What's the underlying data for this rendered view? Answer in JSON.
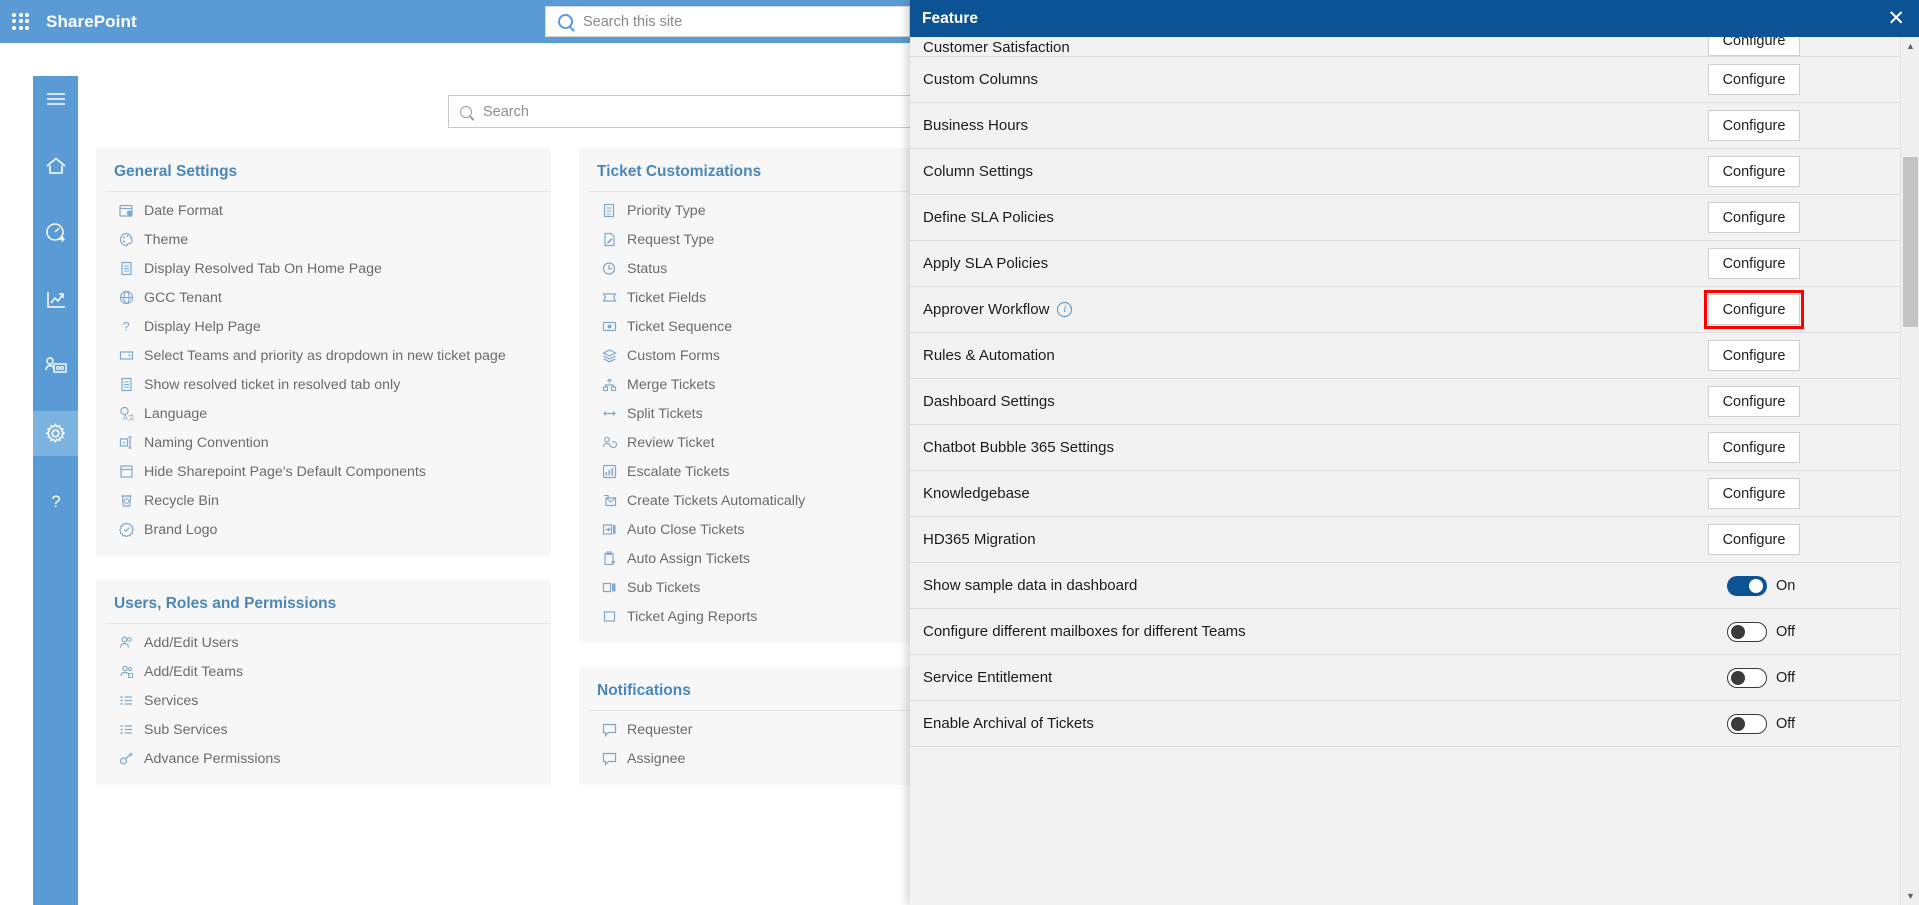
{
  "suitebar": {
    "app_launcher": "waffle-icon",
    "brand": "SharePoint",
    "search_placeholder": "Search this site"
  },
  "rail": {
    "items": [
      {
        "name": "hamburger-menu",
        "label": "Menu"
      },
      {
        "name": "home",
        "label": "Home"
      },
      {
        "name": "dashboard",
        "label": "Dashboard"
      },
      {
        "name": "reports",
        "label": "Reports"
      },
      {
        "name": "teams",
        "label": "Teams"
      },
      {
        "name": "settings",
        "label": "Settings",
        "active": true
      },
      {
        "name": "help",
        "label": "Help"
      }
    ]
  },
  "page": {
    "search_placeholder": "Search"
  },
  "settings_columns": [
    {
      "cards": [
        {
          "title": "General Settings",
          "items": [
            {
              "icon": "calendar-clock-icon",
              "label": "Date Format"
            },
            {
              "icon": "palette-icon",
              "label": "Theme"
            },
            {
              "icon": "document-icon",
              "label": "Display Resolved Tab On Home Page"
            },
            {
              "icon": "globe-icon",
              "label": "GCC Tenant"
            },
            {
              "icon": "question-icon",
              "label": "Display Help Page"
            },
            {
              "icon": "dropdown-icon",
              "label": "Select Teams and priority as dropdown in new ticket page"
            },
            {
              "icon": "document-icon",
              "label": "Show resolved ticket in resolved tab only"
            },
            {
              "icon": "language-icon",
              "label": "Language"
            },
            {
              "icon": "rename-icon",
              "label": "Naming Convention"
            },
            {
              "icon": "page-icon",
              "label": "Hide Sharepoint Page's Default Components"
            },
            {
              "icon": "recycle-bin-icon",
              "label": "Recycle Bin"
            },
            {
              "icon": "badge-icon",
              "label": "Brand Logo"
            }
          ]
        },
        {
          "title": "Users, Roles and Permissions",
          "items": [
            {
              "icon": "users-icon",
              "label": "Add/Edit Users"
            },
            {
              "icon": "team-icon",
              "label": "Add/Edit Teams"
            },
            {
              "icon": "list-icon",
              "label": "Services"
            },
            {
              "icon": "list-icon",
              "label": "Sub Services"
            },
            {
              "icon": "key-icon",
              "label": "Advance Permissions"
            }
          ]
        }
      ]
    },
    {
      "cards": [
        {
          "title": "Ticket Customizations",
          "items": [
            {
              "icon": "priority-icon",
              "label": "Priority Type"
            },
            {
              "icon": "request-icon",
              "label": "Request Type"
            },
            {
              "icon": "clock-icon",
              "label": "Status"
            },
            {
              "icon": "ticket-icon",
              "label": "Ticket Fields"
            },
            {
              "icon": "sequence-icon",
              "label": "Ticket Sequence"
            },
            {
              "icon": "layers-icon",
              "label": "Custom Forms"
            },
            {
              "icon": "merge-icon",
              "label": "Merge Tickets"
            },
            {
              "icon": "split-icon",
              "label": "Split Tickets"
            },
            {
              "icon": "review-icon",
              "label": "Review Ticket"
            },
            {
              "icon": "escalate-icon",
              "label": "Escalate Tickets"
            },
            {
              "icon": "mail-icon",
              "label": "Create Tickets Automatically"
            },
            {
              "icon": "autoclose-icon",
              "label": "Auto Close Tickets"
            },
            {
              "icon": "clipboard-icon",
              "label": "Auto Assign Tickets"
            },
            {
              "icon": "subticket-icon",
              "label": "Sub Tickets"
            },
            {
              "icon": "aging-icon",
              "label": "Ticket Aging Reports"
            }
          ]
        },
        {
          "title": "Notifications",
          "items": [
            {
              "icon": "comment-icon",
              "label": "Requester"
            },
            {
              "icon": "comment-icon",
              "label": "Assignee"
            }
          ]
        }
      ]
    }
  ],
  "feature_panel": {
    "title": "Feature",
    "close_label": "✕",
    "configure_label": "Configure",
    "on_label": "On",
    "off_label": "Off",
    "highlight_color": "#ff0000",
    "accent_color": "#0b5394",
    "rows": [
      {
        "label": "Customer Satisfaction",
        "control": "configure",
        "clipped": true
      },
      {
        "label": "Custom Columns",
        "control": "configure"
      },
      {
        "label": "Business Hours",
        "control": "configure"
      },
      {
        "label": "Column Settings",
        "control": "configure"
      },
      {
        "label": "Define SLA Policies",
        "control": "configure"
      },
      {
        "label": "Apply SLA Policies",
        "control": "configure"
      },
      {
        "label": "Approver Workflow",
        "control": "configure",
        "info": true,
        "highlighted": true
      },
      {
        "label": "Rules & Automation",
        "control": "configure"
      },
      {
        "label": "Dashboard Settings",
        "control": "configure"
      },
      {
        "label": "Chatbot Bubble 365 Settings",
        "control": "configure"
      },
      {
        "label": "Knowledgebase",
        "control": "configure"
      },
      {
        "label": "HD365 Migration",
        "control": "configure"
      },
      {
        "label": "Show sample data in dashboard",
        "control": "toggle",
        "state": "On"
      },
      {
        "label": "Configure different mailboxes for different Teams",
        "control": "toggle",
        "state": "Off"
      },
      {
        "label": "Service Entitlement",
        "control": "toggle",
        "state": "Off"
      },
      {
        "label": "Enable Archival of Tickets",
        "control": "toggle",
        "state": "Off"
      }
    ]
  }
}
